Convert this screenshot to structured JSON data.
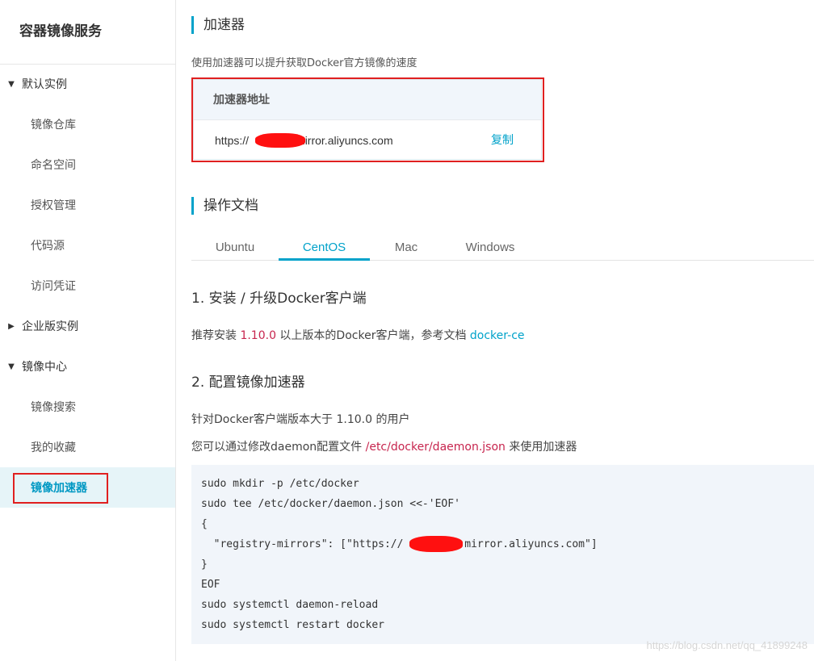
{
  "sidebar": {
    "title": "容器镜像服务",
    "groups": [
      {
        "label": "默认实例",
        "caret": "▼"
      },
      {
        "label": "企业版实例",
        "caret": "▶"
      },
      {
        "label": "镜像中心",
        "caret": "▼"
      }
    ],
    "items": [
      {
        "label": "镜像仓库"
      },
      {
        "label": "命名空间"
      },
      {
        "label": "授权管理"
      },
      {
        "label": "代码源"
      },
      {
        "label": "访问凭证"
      },
      {
        "label": "镜像搜索"
      },
      {
        "label": "我的收藏"
      },
      {
        "label": "镜像加速器"
      }
    ],
    "active_item": "镜像加速器"
  },
  "accelerator": {
    "title": "加速器",
    "description": "使用加速器可以提升获取Docker官方镜像的速度",
    "header": "加速器地址",
    "url_prefix": "https://",
    "url_suffix": "mirror.aliyuncs.com",
    "copy_label": "复制"
  },
  "docs": {
    "title": "操作文档",
    "tabs": [
      "Ubuntu",
      "CentOS",
      "Mac",
      "Windows"
    ],
    "active_tab": "CentOS",
    "step1": {
      "title": "1. 安装 / 升级Docker客户端",
      "text_before": "推荐安装 ",
      "version": "1.10.0",
      "text_after": " 以上版本的Docker客户端，参考文档 ",
      "link": "docker-ce"
    },
    "step2": {
      "title": "2. 配置镜像加速器",
      "line1": "针对Docker客户端版本大于 1.10.0 的用户",
      "line2_before": "您可以通过修改daemon配置文件 ",
      "line2_path": "/etc/docker/daemon.json",
      "line2_after": " 来使用加速器"
    },
    "code_lines": [
      "sudo mkdir -p /etc/docker",
      "sudo tee /etc/docker/daemon.json <<-'EOF'",
      "{",
      "  \"registry-mirrors\": [\"https://",
      "}",
      "EOF",
      "sudo systemctl daemon-reload",
      "sudo systemctl restart docker"
    ],
    "code_mirror_suffix": ".mirror.aliyuncs.com\"]"
  },
  "watermark": "https://blog.csdn.net/qq_41899248",
  "colors": {
    "accent": "#00a2ca",
    "highlight_red": "#c7254e",
    "annotation_red": "#e02020",
    "code_bg": "#f1f5fa"
  }
}
